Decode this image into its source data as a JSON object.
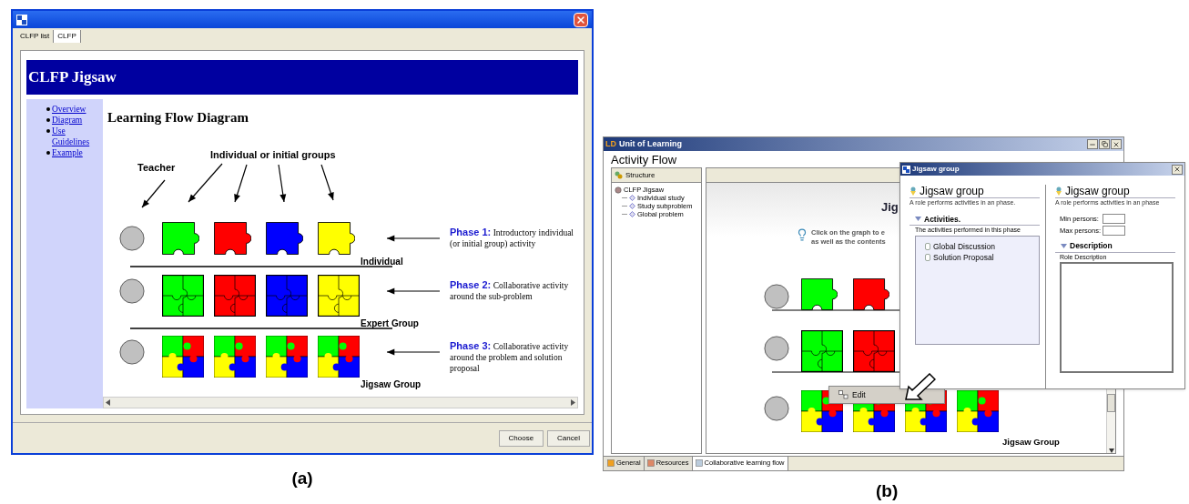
{
  "panel_a": {
    "caption": "(a)",
    "tabs": [
      {
        "label": "CLFP list",
        "selected": false
      },
      {
        "label": "CLFP",
        "selected": true
      }
    ],
    "banner": "CLFP Jigsaw",
    "nav_links": [
      "Overview",
      "Diagram",
      "Use Guidelines",
      "Example"
    ],
    "heading": "Learning Flow Diagram",
    "diagram": {
      "teacher_label": "Teacher",
      "groups_label": "Individual or initial groups",
      "phases": [
        {
          "kind": "single",
          "group_label": "Individual",
          "title": "Phase 1:",
          "description": "Introductory individual (or initial group) activity",
          "pieces": [
            {
              "color": "#00ff00"
            },
            {
              "color": "#ff0000"
            },
            {
              "color": "#0000ff"
            },
            {
              "color": "#ffff00"
            }
          ]
        },
        {
          "kind": "quad",
          "group_label": "Expert Group",
          "title": "Phase 2:",
          "description": "Collaborative activity around the sub-problem",
          "pieces": [
            {
              "color": "#00ff00"
            },
            {
              "color": "#ff0000"
            },
            {
              "color": "#0000ff"
            },
            {
              "color": "#ffff00"
            }
          ]
        },
        {
          "kind": "mixed",
          "group_label": "Jigsaw Group",
          "title": "Phase 3:",
          "description": "Collaborative activity around the problem and solution proposal",
          "pieces": [
            {
              "quadrants": [
                {
                  "color": "#00ff00"
                },
                {
                  "color": "#ff0000"
                },
                {
                  "color": "#ffff00"
                },
                {
                  "color": "#0000ff"
                }
              ]
            },
            {
              "quadrants": [
                {
                  "color": "#00ff00"
                },
                {
                  "color": "#ff0000"
                },
                {
                  "color": "#ffff00"
                },
                {
                  "color": "#0000ff"
                }
              ]
            },
            {
              "quadrants": [
                {
                  "color": "#00ff00"
                },
                {
                  "color": "#ff0000"
                },
                {
                  "color": "#ffff00"
                },
                {
                  "color": "#0000ff"
                }
              ]
            },
            {
              "quadrants": [
                {
                  "color": "#00ff00"
                },
                {
                  "color": "#ff0000"
                },
                {
                  "color": "#ffff00"
                },
                {
                  "color": "#0000ff"
                }
              ]
            }
          ]
        }
      ]
    },
    "buttons": [
      "Choose",
      "Cancel"
    ]
  },
  "panel_b": {
    "caption": "(b)",
    "app_badge": "LD",
    "title": "Unit of Learning",
    "section_title": "Activity Flow",
    "structure_tab": "Structure",
    "tree": {
      "label": "CLFP Jigsaw",
      "children": [
        {
          "label": "Individual study"
        },
        {
          "label": "Study subproblem"
        },
        {
          "label": "Global problem"
        }
      ]
    },
    "canvas": {
      "title": "Jig",
      "hint_lines": [
        "Click on the graph to e",
        "as well as the contents"
      ],
      "phases": [
        {
          "kind": "single",
          "pieces": [
            {
              "color": "#00ff00"
            },
            {
              "color": "#ff0000"
            }
          ]
        },
        {
          "kind": "quad",
          "pieces": [
            {
              "color": "#00ff00"
            },
            {
              "color": "#ff0000"
            }
          ]
        },
        {
          "kind": "mixed",
          "group_label": "Jigsaw Group",
          "pieces": [
            {
              "quadrants": [
                {
                  "color": "#00ff00"
                },
                {
                  "color": "#ff0000"
                },
                {
                  "color": "#ffff00"
                },
                {
                  "color": "#0000ff"
                }
              ]
            },
            {
              "quadrants": [
                {
                  "color": "#00ff00"
                },
                {
                  "color": "#ff0000"
                },
                {
                  "color": "#ffff00"
                },
                {
                  "color": "#0000ff"
                }
              ]
            },
            {
              "quadrants": [
                {
                  "color": "#00ff00"
                },
                {
                  "color": "#ff0000"
                },
                {
                  "color": "#ffff00"
                },
                {
                  "color": "#0000ff"
                }
              ]
            },
            {
              "quadrants": [
                {
                  "color": "#00ff00"
                },
                {
                  "color": "#ff0000"
                },
                {
                  "color": "#ffff00"
                },
                {
                  "color": "#0000ff"
                }
              ]
            }
          ]
        }
      ]
    },
    "context_menu": [
      "Edit"
    ],
    "bottom_tabs": [
      {
        "label": "General",
        "selected": false
      },
      {
        "label": "Resources",
        "selected": false
      },
      {
        "label": "Collaborative learning flow",
        "selected": true
      }
    ],
    "dialog": {
      "title": "Jigsaw group",
      "left": {
        "heading": "Jigsaw group",
        "subtitle": "A role performs activities in an phase.",
        "section": "Activities.",
        "caption": "The activities performed in this phase",
        "activities": [
          "Global Discussion",
          "Solution Proposal"
        ]
      },
      "right": {
        "heading": "Jigsaw group",
        "subtitle": "A role performs activities in an phase",
        "fields": [
          {
            "label": "Min persons:"
          },
          {
            "label": "Max persons:"
          }
        ],
        "section": "Description",
        "field_label": "Role Description"
      }
    }
  }
}
